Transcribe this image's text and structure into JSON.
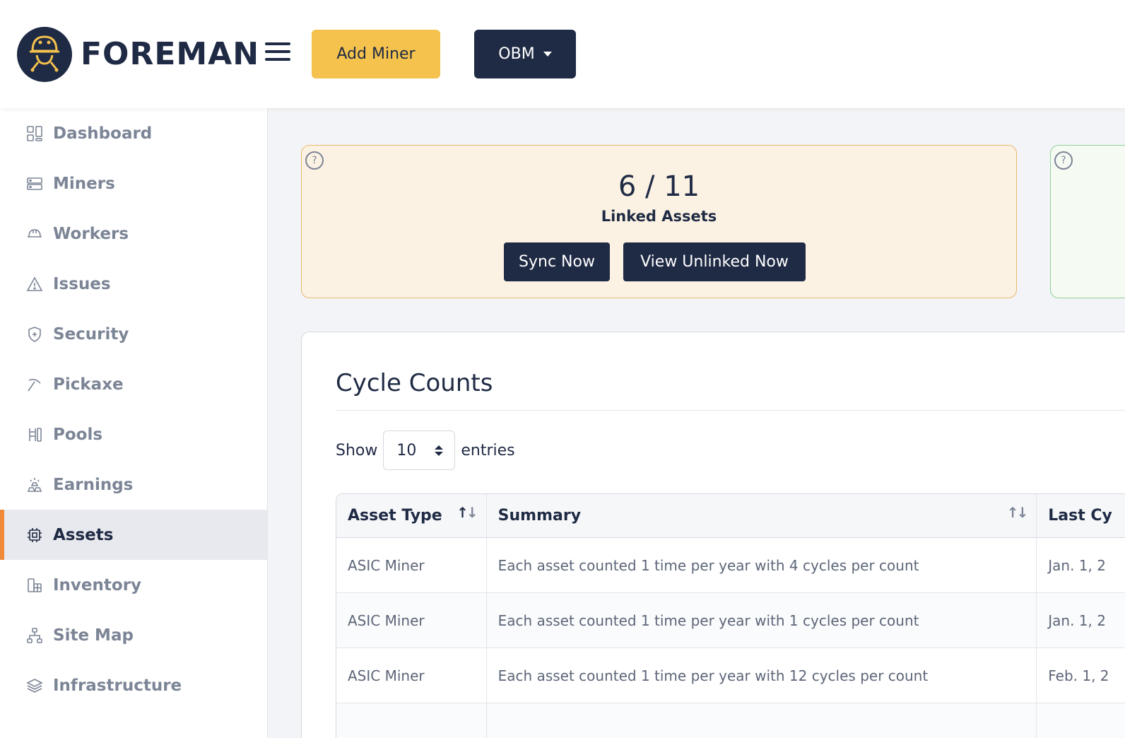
{
  "header": {
    "brand": "FOREMAN",
    "add_miner_label": "Add Miner",
    "org_label": "OBM"
  },
  "sidebar": {
    "items": [
      {
        "label": "Dashboard",
        "icon": "dashboard-icon"
      },
      {
        "label": "Miners",
        "icon": "server-icon"
      },
      {
        "label": "Workers",
        "icon": "hardhat-icon"
      },
      {
        "label": "Issues",
        "icon": "warning-icon"
      },
      {
        "label": "Security",
        "icon": "shield-icon"
      },
      {
        "label": "Pickaxe",
        "icon": "pickaxe-icon"
      },
      {
        "label": "Pools",
        "icon": "pools-icon"
      },
      {
        "label": "Earnings",
        "icon": "gold-bars-icon"
      },
      {
        "label": "Assets",
        "icon": "chip-icon",
        "active": true
      },
      {
        "label": "Inventory",
        "icon": "inventory-icon"
      },
      {
        "label": "Site Map",
        "icon": "sitemap-icon"
      },
      {
        "label": "Infrastructure",
        "icon": "layers-icon"
      }
    ]
  },
  "stats": {
    "linked_value": "6 / 11",
    "linked_label": "Linked Assets",
    "sync_label": "Sync Now",
    "view_unlinked_label": "View Unlinked Now",
    "help_symbol": "?"
  },
  "cycle_counts": {
    "title": "Cycle Counts",
    "show_label": "Show",
    "page_size": "10",
    "entries_label": "entries",
    "columns": [
      "Asset Type",
      "Summary",
      "Last Cy"
    ],
    "rows": [
      [
        "ASIC Miner",
        "Each asset counted 1 time per year with 4 cycles per count",
        "Jan. 1, 2"
      ],
      [
        "ASIC Miner",
        "Each asset counted 1 time per year with 1 cycles per count",
        "Jan. 1, 2"
      ],
      [
        "ASIC Miner",
        "Each asset counted 1 time per year with 12 cycles per count",
        "Feb. 1, 2"
      ]
    ]
  },
  "colors": {
    "navy": "#1f2a44",
    "accent_yellow": "#f4c24d",
    "active_marker": "#f08a3b",
    "warning_card_bg": "#fbf2e3",
    "success_card_border": "#8fd197"
  }
}
